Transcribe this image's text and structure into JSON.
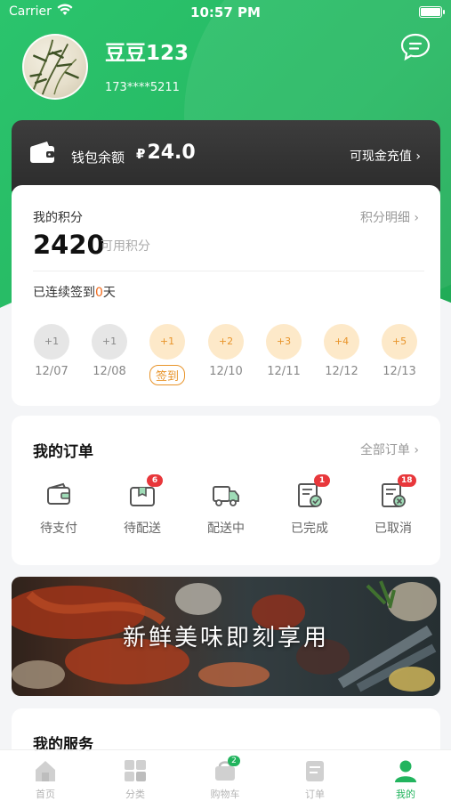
{
  "status_bar": {
    "carrier": "Carrier",
    "time": "10:57 PM"
  },
  "profile": {
    "username": "豆豆123",
    "phone": "173****5211"
  },
  "wallet": {
    "label": "钱包余额",
    "currency": "₽",
    "amount": "24.0",
    "recharge_label": "可现金充值 ›"
  },
  "points": {
    "title": "我的积分",
    "detail_link": "积分明细 ›",
    "value": "2420",
    "unit_label": "可用积分",
    "streak_prefix": "已连续签到",
    "streak_days": "0",
    "streak_suffix": "天",
    "days": [
      {
        "bonus": "+1",
        "date": "12/07"
      },
      {
        "bonus": "+1",
        "date": "12/08"
      },
      {
        "bonus": "+1",
        "action": "签到"
      },
      {
        "bonus": "+2",
        "date": "12/10"
      },
      {
        "bonus": "+3",
        "date": "12/11"
      },
      {
        "bonus": "+4",
        "date": "12/12"
      },
      {
        "bonus": "+5",
        "date": "12/13"
      }
    ]
  },
  "orders": {
    "title": "我的订单",
    "all_link": "全部订单 ›",
    "items": [
      {
        "label": "待支付",
        "icon": "wallet-icon"
      },
      {
        "label": "待配送",
        "icon": "package-icon",
        "badge": "6"
      },
      {
        "label": "配送中",
        "icon": "delivery-truck-icon"
      },
      {
        "label": "已完成",
        "icon": "completed-list-icon",
        "badge": "1"
      },
      {
        "label": "已取消",
        "icon": "cancelled-list-icon",
        "badge": "18"
      }
    ]
  },
  "banner": {
    "text": "新鲜美味即刻享用"
  },
  "services": {
    "title": "我的服务"
  },
  "tabbar": {
    "tabs": [
      {
        "label": "首页",
        "icon": "home-icon"
      },
      {
        "label": "分类",
        "icon": "category-icon"
      },
      {
        "label": "购物车",
        "icon": "cart-icon",
        "badge": "2"
      },
      {
        "label": "订单",
        "icon": "order-icon"
      },
      {
        "label": "我的",
        "icon": "profile-icon",
        "active": true
      }
    ]
  },
  "colors": {
    "brand_green": "#22b45e",
    "badge_red": "#e8373b",
    "points_orange": "#e8942a",
    "wallet_dark": "#333333"
  }
}
